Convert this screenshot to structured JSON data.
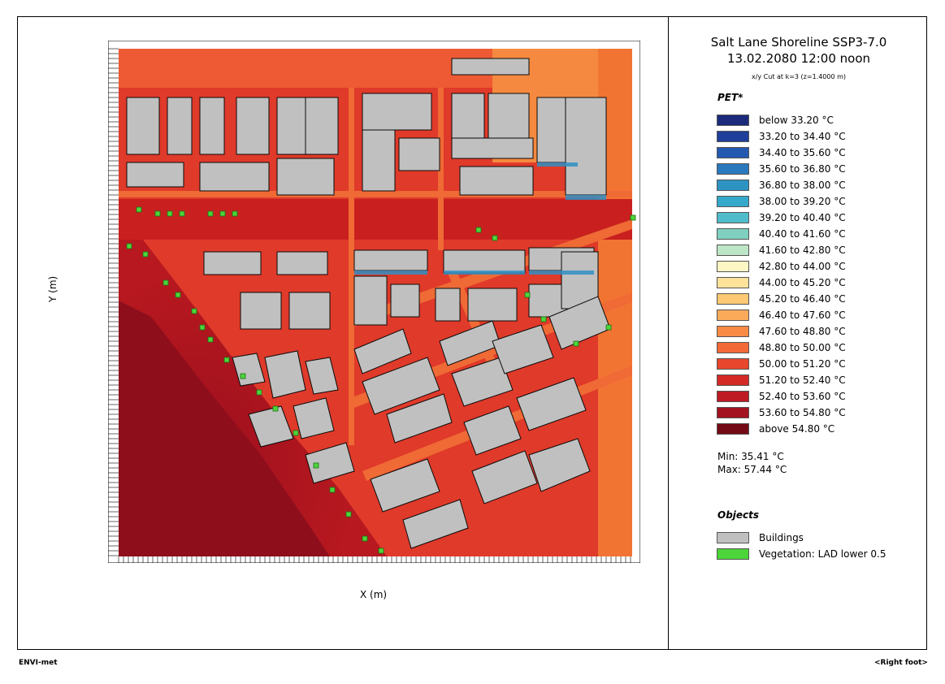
{
  "header": {
    "title": "Salt Lane Shoreline SSP3-7.0",
    "datetime": "13.02.2080 12:00 noon",
    "cut": "x/y Cut at k=3 (z=1.4000 m)"
  },
  "axes": {
    "x_label": "X (m)",
    "y_label": "Y (m)"
  },
  "legend": {
    "title": "PET*",
    "items": [
      {
        "label": "below 33.20 °C",
        "color": "#1b2a7a"
      },
      {
        "label": "33.20 to 34.40 °C",
        "color": "#1f3f9a"
      },
      {
        "label": "34.40 to 35.60 °C",
        "color": "#2459b0"
      },
      {
        "label": "35.60 to 36.80 °C",
        "color": "#2a78bd"
      },
      {
        "label": "36.80 to 38.00 °C",
        "color": "#2d93c3"
      },
      {
        "label": "38.00 to 39.20 °C",
        "color": "#34a9c9"
      },
      {
        "label": "39.20 to 40.40 °C",
        "color": "#4fbccb"
      },
      {
        "label": "40.40 to 41.60 °C",
        "color": "#7fd0bf"
      },
      {
        "label": "41.60 to 42.80 °C",
        "color": "#bde6c6"
      },
      {
        "label": "42.80 to 44.00 °C",
        "color": "#fbf6c4"
      },
      {
        "label": "44.00 to 45.20 °C",
        "color": "#fde29a"
      },
      {
        "label": "45.20 to 46.40 °C",
        "color": "#fdc873"
      },
      {
        "label": "46.40 to 47.60 °C",
        "color": "#fbaa5a"
      },
      {
        "label": "47.60 to 48.80 °C",
        "color": "#f88a45"
      },
      {
        "label": "48.80 to 50.00 °C",
        "color": "#f26a38"
      },
      {
        "label": "50.00 to 51.20 °C",
        "color": "#e8462d"
      },
      {
        "label": "51.20 to 52.40 °C",
        "color": "#d42a26"
      },
      {
        "label": "52.40 to 53.60 °C",
        "color": "#be1a23"
      },
      {
        "label": "53.60 to 54.80 °C",
        "color": "#a3121f"
      },
      {
        "label": "above 54.80 °C",
        "color": "#730a16"
      }
    ]
  },
  "stats": {
    "min": "Min: 35.41 °C",
    "max": "Max: 57.44 °C"
  },
  "objects": {
    "title": "Objects",
    "items": [
      {
        "label": "Buildings",
        "color": "#c0c0c0"
      },
      {
        "label": "Vegetation: LAD lower 0.5",
        "color": "#4cd53a"
      }
    ]
  },
  "footer": {
    "left": "ENVI-met",
    "right": "<Right foot>"
  }
}
